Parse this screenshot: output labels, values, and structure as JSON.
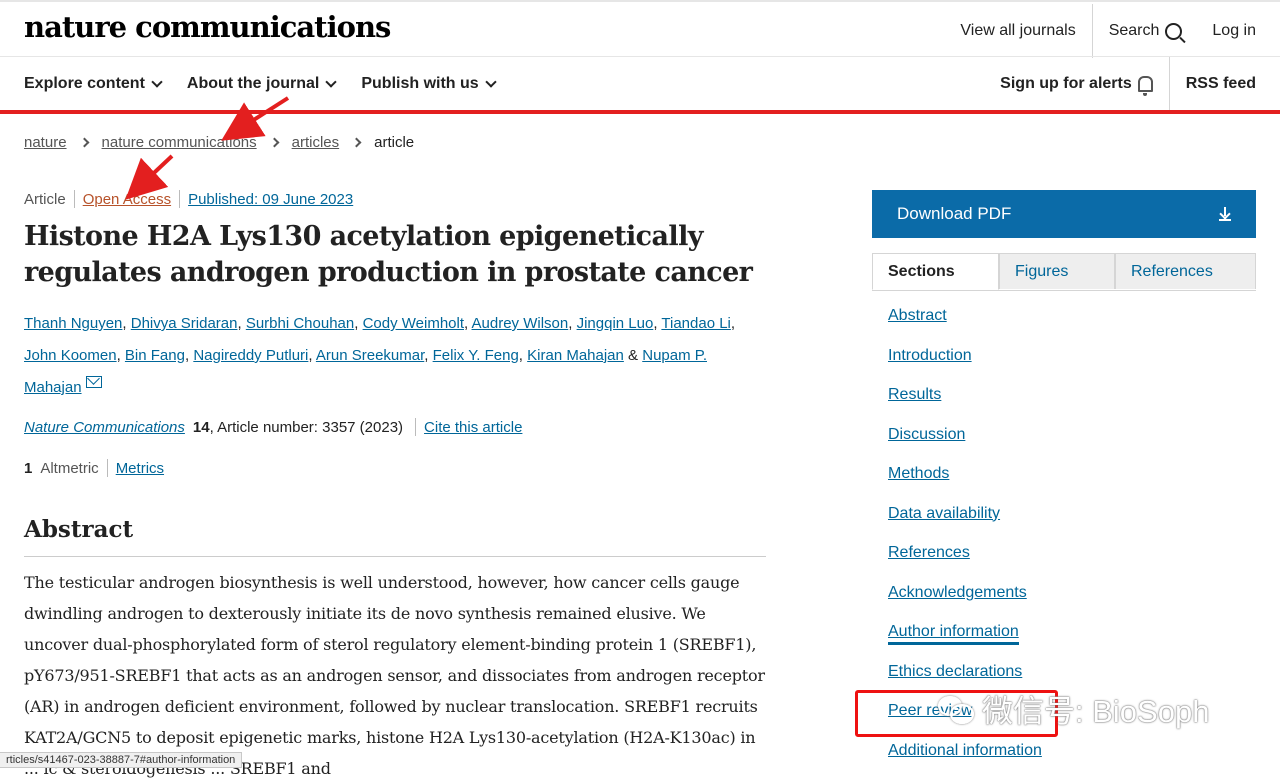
{
  "header": {
    "logo": "nature communications",
    "view_all_journals": "View all journals",
    "search": "Search",
    "login": "Log in"
  },
  "nav": {
    "items": [
      "Explore content",
      "About the journal",
      "Publish with us"
    ],
    "alerts": "Sign up for alerts",
    "rss": "RSS feed"
  },
  "breadcrumb": [
    "nature",
    "nature communications",
    "articles",
    "article"
  ],
  "article": {
    "type": "Article",
    "access": "Open Access",
    "published": "Published: 09 June 2023",
    "title": "Histone H2A Lys130 acetylation epigenetically regulates androgen production in prostate cancer",
    "authors": [
      "Thanh Nguyen",
      "Dhivya Sridaran",
      "Surbhi Chouhan",
      "Cody Weimholt",
      "Audrey Wilson",
      "Jingqin Luo",
      "Tiandao Li",
      "John Koomen",
      "Bin Fang",
      "Nagireddy Putluri",
      "Arun Sreekumar",
      "Felix Y. Feng",
      "Kiran Mahajan",
      "Nupam P. Mahajan"
    ],
    "authors_and": "&",
    "journal": "Nature Communications",
    "volume": "14",
    "article_number": ", Article number: 3357 (2023)",
    "cite": "Cite this article",
    "altmetric_count": "1",
    "altmetric_label": "Altmetric",
    "metrics": "Metrics"
  },
  "abstract": {
    "heading": "Abstract",
    "text": "The testicular androgen biosynthesis is well understood, however, how cancer cells gauge dwindling androgen to dexterously initiate its de novo synthesis remained elusive. We uncover dual-phosphorylated form of sterol regulatory element-binding protein 1 (SREBF1), pY673/951-SREBF1 that acts as an androgen sensor, and dissociates from androgen receptor (AR) in androgen deficient environment, followed by nuclear translocation. SREBF1 recruits KAT2A/GCN5 to deposit epigenetic marks, histone H2A Lys130-acetylation (H2A-K130ac) in ... ic & steroidogenesis ... SREBF1 and"
  },
  "sidebar": {
    "download": "Download PDF",
    "tabs": [
      "Sections",
      "Figures",
      "References"
    ],
    "sections": [
      "Abstract",
      "Introduction",
      "Results",
      "Discussion",
      "Methods",
      "Data availability",
      "References",
      "Acknowledgements",
      "Author information",
      "Ethics declarations",
      "Peer review",
      "Additional information"
    ]
  },
  "status_bar_url": "rticles/s41467-023-38887-7#author-information",
  "watermark": "微信号: BioSoph",
  "colors": {
    "accent_red": "#e31f1f",
    "link_blue": "#006699",
    "button_blue": "#0b6ba8",
    "open_access": "#b7522a"
  }
}
